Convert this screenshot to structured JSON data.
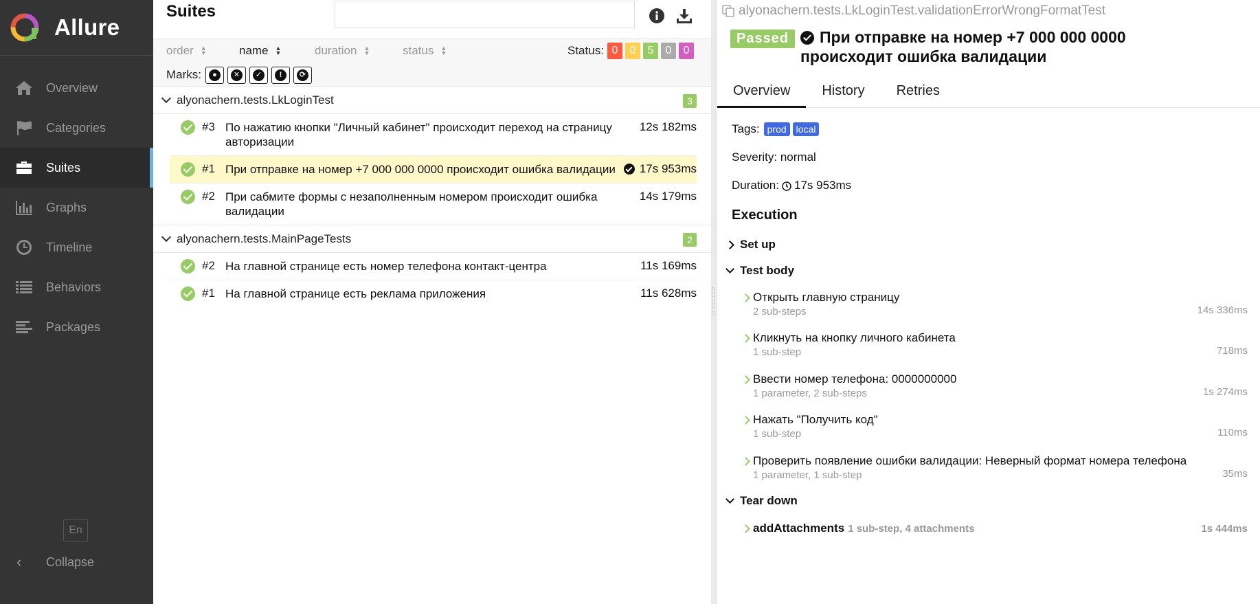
{
  "brand": {
    "name": "Allure"
  },
  "sidebar": {
    "items": [
      {
        "label": "Overview",
        "icon": "home-icon"
      },
      {
        "label": "Categories",
        "icon": "flag-icon"
      },
      {
        "label": "Suites",
        "icon": "briefcase-icon",
        "active": true
      },
      {
        "label": "Graphs",
        "icon": "bar-chart-icon"
      },
      {
        "label": "Timeline",
        "icon": "clock-icon"
      },
      {
        "label": "Behaviors",
        "icon": "list-icon"
      },
      {
        "label": "Packages",
        "icon": "align-left-icon"
      }
    ],
    "language": "En",
    "collapse": "Collapse"
  },
  "suites": {
    "title": "Suites",
    "sorters": [
      {
        "label": "order"
      },
      {
        "label": "name",
        "active": true
      },
      {
        "label": "duration"
      },
      {
        "label": "status"
      }
    ],
    "status_label": "Status:",
    "status_counts": [
      {
        "value": "0",
        "color": "#fd5a3e"
      },
      {
        "value": "0",
        "color": "#ffd050"
      },
      {
        "value": "5",
        "color": "#97cc64"
      },
      {
        "value": "0",
        "color": "#aaaaaa"
      },
      {
        "value": "0",
        "color": "#d35ebe"
      }
    ],
    "marks_label": "Marks:",
    "groups": [
      {
        "name": "alyonachern.tests.LkLoginTest",
        "count": "3",
        "tests": [
          {
            "num": "#3",
            "title": "По нажатию кнопки \"Личный кабинет\" происходит переход на страницу авторизации",
            "duration": "12s 182ms"
          },
          {
            "num": "#1",
            "title": "При отправке на номер +7 000 000 0000 происходит ошибка валидации",
            "duration": "17s 953ms",
            "selected": true
          },
          {
            "num": "#2",
            "title": "При сабмите формы с незаполненным номером происходит ошибка валидации",
            "duration": "14s 179ms"
          }
        ]
      },
      {
        "name": "alyonachern.tests.MainPageTests",
        "count": "2",
        "tests": [
          {
            "num": "#2",
            "title": "На главной странице есть номер телефона контакт-центра",
            "duration": "11s 169ms"
          },
          {
            "num": "#1",
            "title": "На главной странице есть реклама приложения",
            "duration": "11s 628ms"
          }
        ]
      }
    ]
  },
  "detail": {
    "path": "alyonachern.tests.LkLoginTest.validationErrorWrongFormatTest",
    "status": "Passed",
    "title": "При отправке на номер +7 000 000 0000 происходит ошибка валидации",
    "tabs": [
      "Overview",
      "History",
      "Retries"
    ],
    "tags_label": "Tags:",
    "tags": [
      "prod",
      "local"
    ],
    "severity": "Severity: normal",
    "duration_label": "Duration:",
    "duration": "17s 953ms",
    "execution_heading": "Execution",
    "setup": "Set up",
    "test_body": "Test body",
    "teardown": "Tear down",
    "steps": [
      {
        "name": "Открыть главную страницу",
        "sub": "2 sub-steps",
        "duration": "14s 336ms"
      },
      {
        "name": "Кликнуть на кнопку личного кабинета",
        "sub": "1 sub-step",
        "duration": "718ms"
      },
      {
        "name": "Ввести номер телефона: 0000000000",
        "sub": "1 parameter, 2 sub-steps",
        "duration": "1s 274ms"
      },
      {
        "name": "Нажать \"Получить код\"",
        "sub": "1 sub-step",
        "duration": "110ms"
      },
      {
        "name": "Проверить появление ошибки валидации: Неверный формат номера телефона",
        "sub": "1 parameter, 1 sub-step",
        "duration": "35ms"
      }
    ],
    "teardown_step": {
      "name": "addAttachments",
      "sub": "1 sub-step, 4 attachments",
      "duration": "1s 444ms"
    }
  }
}
